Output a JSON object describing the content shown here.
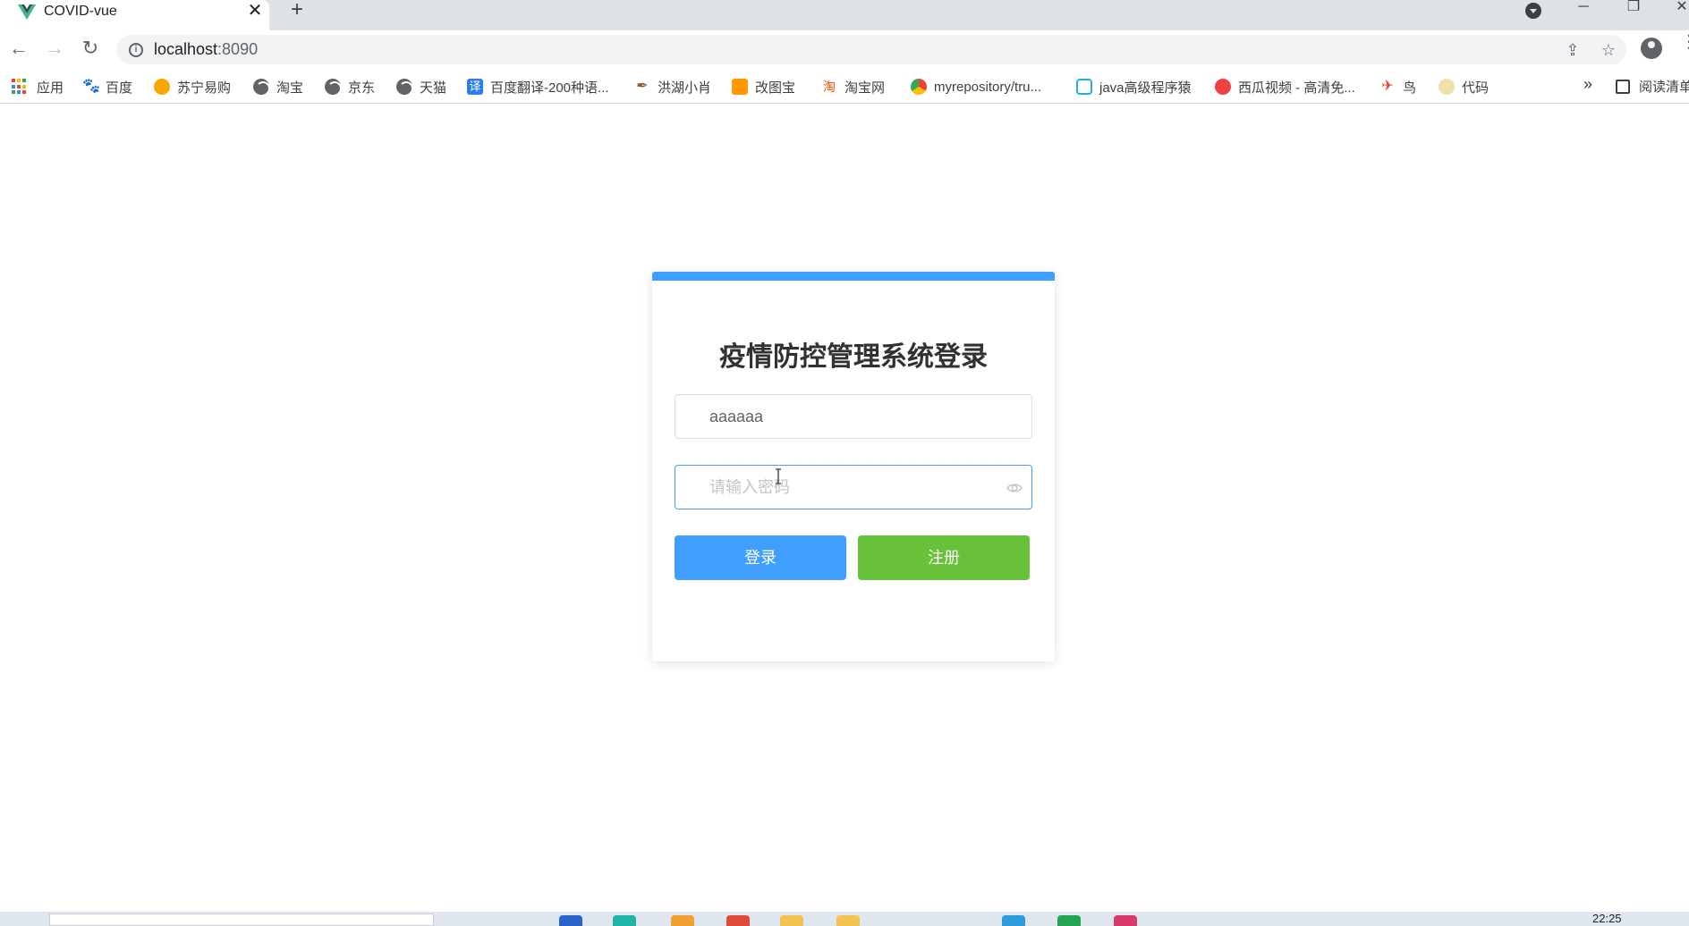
{
  "browser": {
    "tab": {
      "title": "COVID-vue",
      "close": "✕"
    },
    "new_tab": "+",
    "window": {
      "minimize": "─",
      "restore": "❐",
      "close": "✕"
    },
    "url": {
      "host": "localhost",
      "port": ":8090"
    }
  },
  "bookmarks": [
    {
      "label": "应用",
      "icon": "apps-icon"
    },
    {
      "label": "百度",
      "icon": "baidu-icon",
      "color": "#2932e1"
    },
    {
      "label": "苏宁易购",
      "icon": "suning-icon",
      "color": "#f7a800"
    },
    {
      "label": "淘宝",
      "icon": "globe-icon"
    },
    {
      "label": "京东",
      "icon": "globe-icon"
    },
    {
      "label": "天猫",
      "icon": "globe-icon"
    },
    {
      "label": "百度翻译-200种语...",
      "icon": "translate-icon",
      "color": "#2a7ef2",
      "glyph": "译"
    },
    {
      "label": "洪湖小肖",
      "icon": "bird-icon",
      "color": "#8a5a2b"
    },
    {
      "label": "改图宝",
      "icon": "gaitubao-icon",
      "color": "#ff9800"
    },
    {
      "label": "淘宝网",
      "icon": "taobao-icon",
      "color": "#ff5000",
      "glyph": "淘"
    },
    {
      "label": "myrepository/tru...",
      "icon": "chrome-icon"
    },
    {
      "label": "java高级程序猿",
      "icon": "bilibili-icon",
      "color": "#23ade5"
    },
    {
      "label": "西瓜视频 - 高清免...",
      "icon": "xigua-icon",
      "color": "#f04142"
    },
    {
      "label": "鸟",
      "icon": "bird-red-icon",
      "color": "#e8412b"
    },
    {
      "label": "代码",
      "icon": "code-icon",
      "color": "#e9e4a6"
    }
  ],
  "bookmarks_more": "»",
  "reading_list": "阅读清单",
  "login": {
    "title": "疫情防控管理系统登录",
    "username_value": "aaaaaa",
    "password_placeholder": "请输入密码",
    "login_button": "登录",
    "register_button": "注册"
  },
  "colors": {
    "primary": "#409eff",
    "success": "#67c23a",
    "border": "#dcdfe6"
  },
  "taskbar": {
    "time": "22:25"
  }
}
